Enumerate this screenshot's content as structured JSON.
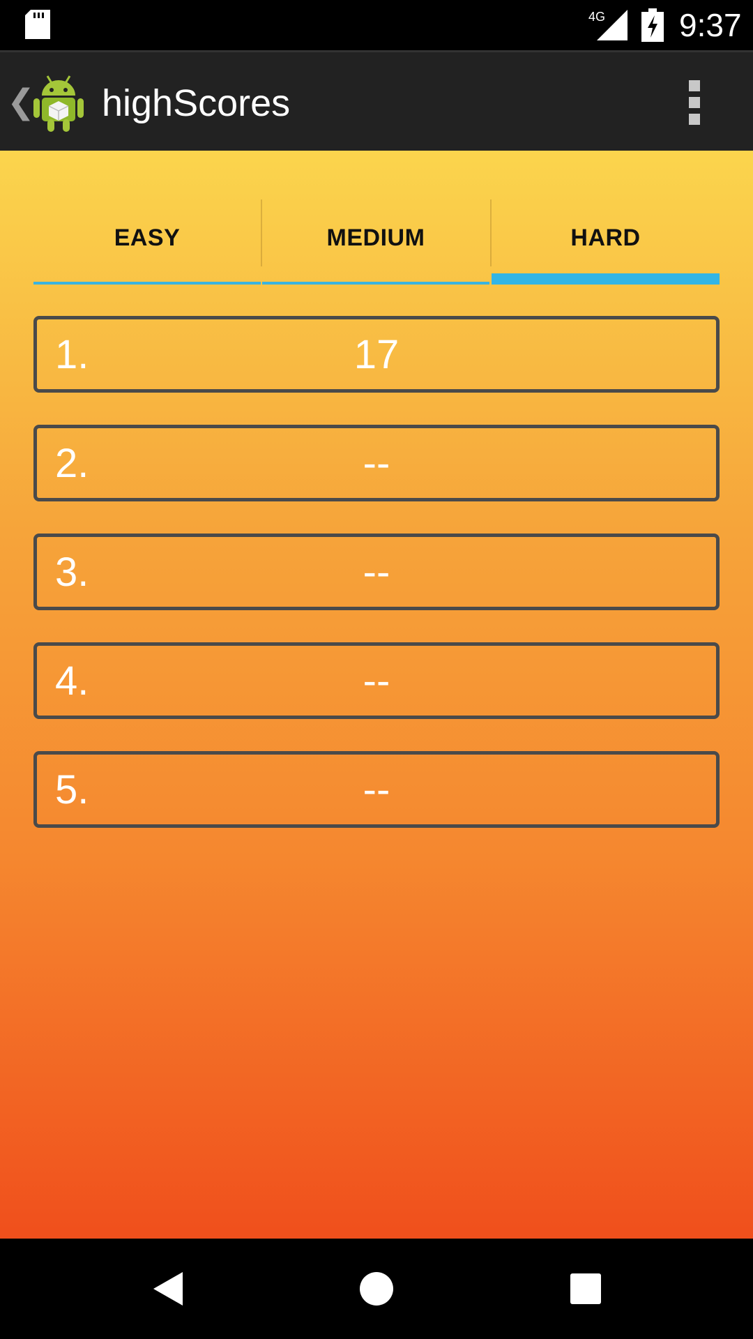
{
  "status_bar": {
    "network": "4G",
    "time": "9:37"
  },
  "action_bar": {
    "title": "highScores"
  },
  "tabs": [
    {
      "label": "EASY",
      "selected": false
    },
    {
      "label": "MEDIUM",
      "selected": false
    },
    {
      "label": "HARD",
      "selected": true
    }
  ],
  "scores": [
    {
      "rank": "1.",
      "score": "17"
    },
    {
      "rank": "2.",
      "score": "--"
    },
    {
      "rank": "3.",
      "score": "--"
    },
    {
      "rank": "4.",
      "score": "--"
    },
    {
      "rank": "5.",
      "score": "--"
    }
  ],
  "colors": {
    "accent": "#33b5e5",
    "gradient_top": "#fbd54d",
    "gradient_bottom": "#f04f1c",
    "action_bar": "#222222"
  }
}
